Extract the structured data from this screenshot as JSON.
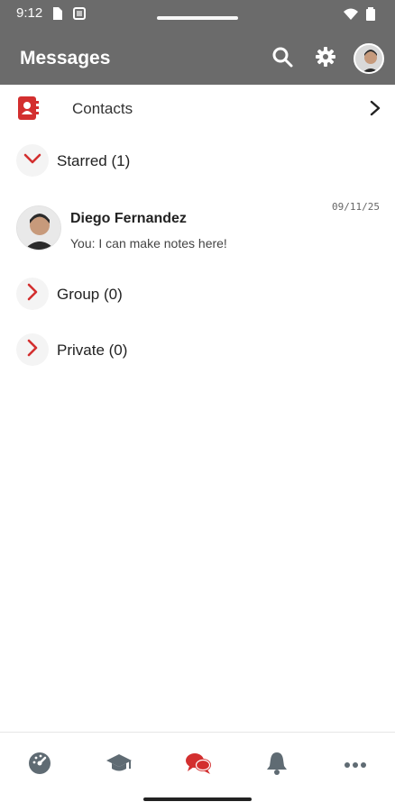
{
  "status_bar": {
    "time": "9:12"
  },
  "app_bar": {
    "title": "Messages",
    "actions": [
      {
        "name": "search",
        "icon": "search-icon"
      },
      {
        "name": "settings",
        "icon": "gear-icon"
      },
      {
        "name": "profile",
        "icon": "avatar"
      }
    ]
  },
  "contacts": {
    "label": "Contacts",
    "icon": "contacts-book-icon"
  },
  "sections": {
    "starred": {
      "label": "Starred (1)",
      "expanded": true
    },
    "group": {
      "label": "Group (0)",
      "expanded": false
    },
    "private": {
      "label": "Private (0)",
      "expanded": false
    }
  },
  "conversation": {
    "name": "Diego Fernandez",
    "preview": "You: I can make notes here!",
    "date": "09/11/25"
  },
  "bottom_nav": {
    "items": [
      {
        "name": "dashboard",
        "icon": "speedometer-icon",
        "active": false
      },
      {
        "name": "courses",
        "icon": "graduation-cap-icon",
        "active": false
      },
      {
        "name": "messages",
        "icon": "chat-bubbles-icon",
        "active": true
      },
      {
        "name": "notifications",
        "icon": "bell-icon",
        "active": false
      },
      {
        "name": "more",
        "icon": "more-dots-icon",
        "active": false
      }
    ]
  },
  "colors": {
    "app_bar": "#6b6b6b",
    "accent_red": "#d32f2f",
    "nav_gray": "#5f6b73"
  }
}
